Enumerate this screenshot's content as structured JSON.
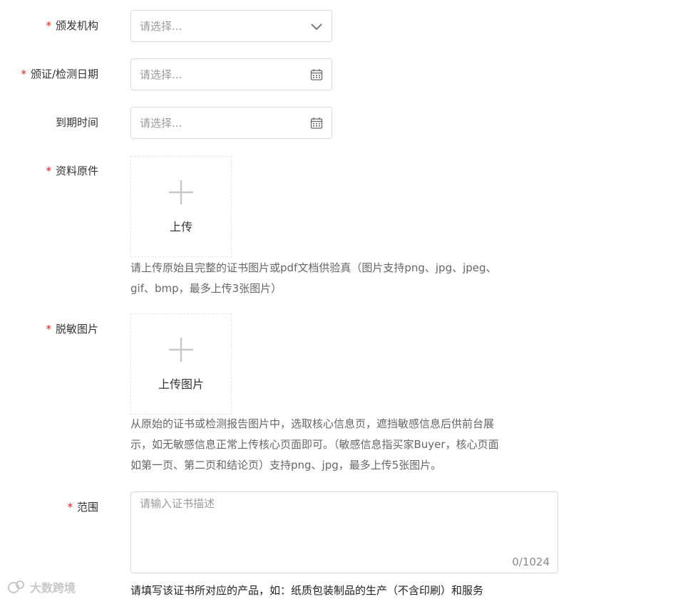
{
  "form": {
    "issuer": {
      "label": "颁发机构",
      "required": true,
      "placeholder": "请选择...",
      "suffix_icon": "chevron-down-icon"
    },
    "issue_date": {
      "label": "颁证/检测日期",
      "required": true,
      "placeholder": "请选择...",
      "suffix_icon": "calendar-icon"
    },
    "expiry_date": {
      "label": "到期时间",
      "required": false,
      "placeholder": "请选择...",
      "suffix_icon": "calendar-icon"
    },
    "original_docs": {
      "label": "资料原件",
      "required": true,
      "upload_label": "上传",
      "hint_lines": [
        "请上传原始且完整的证书图片或pdf文档供验真（图片支持png、jpg、jpeg、",
        "gif、bmp，最多上传3张图片）"
      ]
    },
    "desensitized": {
      "label": "脱敏图片",
      "required": true,
      "upload_label": "上传图片",
      "hint_lines": [
        "从原始的证书或检测报告图片中，选取核心信息页，遮挡敏感信息后供前台展",
        "示，如无敏感信息正常上传核心页面即可。（敏感信息指买家Buyer，核心页面",
        "如第一页、第二页和结论页）支持png、jpg，最多上传5张图片。"
      ]
    },
    "scope": {
      "label": "范围",
      "required": true,
      "placeholder": "请输入证书描述",
      "counter": "0/1024",
      "hint": "请填写该证书所对应的产品，如：纸质包装制品的生产（不含印刷）和服务"
    }
  },
  "required_mark": "*",
  "watermark": "大数跨境",
  "colors": {
    "required": "#e2231a",
    "border": "#d9d9d9",
    "placeholder": "#999999"
  }
}
